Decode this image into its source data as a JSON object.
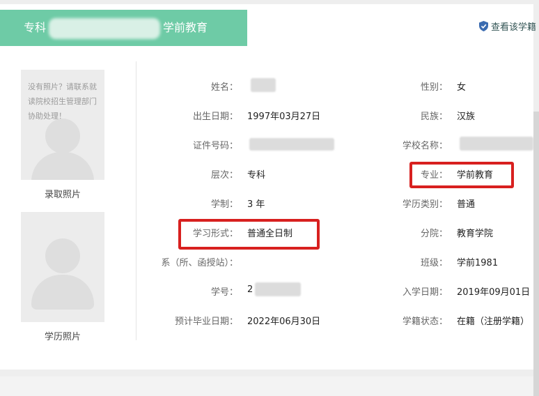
{
  "header": {
    "title_prefix": "专科",
    "title_suffix": "学前教育",
    "view_link": "查看该学籍"
  },
  "photos": {
    "placeholder_note": "没有照片？请联系就读院校招生管理部门协助处理！",
    "admission_label": "录取照片",
    "diploma_label": "学历照片"
  },
  "left_fields": [
    {
      "label": "姓名：",
      "value": ""
    },
    {
      "label": "出生日期：",
      "value": "1997年03月27日"
    },
    {
      "label": "证件号码：",
      "value": ""
    },
    {
      "label": "层次：",
      "value": "专科"
    },
    {
      "label": "学制：",
      "value": "3 年"
    },
    {
      "label": "学习形式：",
      "value": "普通全日制"
    },
    {
      "label": "系（所、函授站）：",
      "value": ""
    },
    {
      "label": "学号：",
      "value": "2"
    },
    {
      "label": "预计毕业日期：",
      "value": "2022年06月30日"
    }
  ],
  "right_fields": [
    {
      "label": "性别：",
      "value": "女"
    },
    {
      "label": "民族：",
      "value": "汉族"
    },
    {
      "label": "学校名称：",
      "value": ""
    },
    {
      "label": "专业：",
      "value": "学前教育"
    },
    {
      "label": "学历类别：",
      "value": "普通"
    },
    {
      "label": "分院：",
      "value": "教育学院"
    },
    {
      "label": "班级：",
      "value": "学前1981"
    },
    {
      "label": "入学日期：",
      "value": "2019年09月01日"
    },
    {
      "label": "学籍状态：",
      "value": "在籍（注册学籍）"
    }
  ],
  "colors": {
    "header_bg": "#6ecba6",
    "highlight": "#d8201f",
    "shield": "#3a6bb0"
  }
}
